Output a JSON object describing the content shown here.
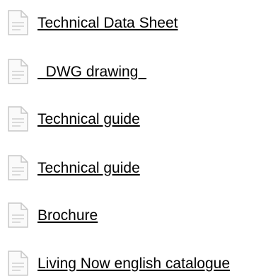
{
  "documents": [
    {
      "label": "Technical Data Sheet",
      "icon": "document-icon"
    },
    {
      "label": "  DWG drawing  ",
      "icon": "document-icon"
    },
    {
      "label": "Technical guide",
      "icon": "document-icon"
    },
    {
      "label": "Technical guide",
      "icon": "document-icon"
    },
    {
      "label": "Brochure",
      "icon": "document-icon"
    },
    {
      "label": "Living Now english catalogue",
      "icon": "document-icon"
    }
  ],
  "colors": {
    "icon_outline": "#c8c8c8",
    "icon_fill": "#fafafa",
    "icon_lines": "#cfcfcf",
    "link_text": "#000000"
  }
}
